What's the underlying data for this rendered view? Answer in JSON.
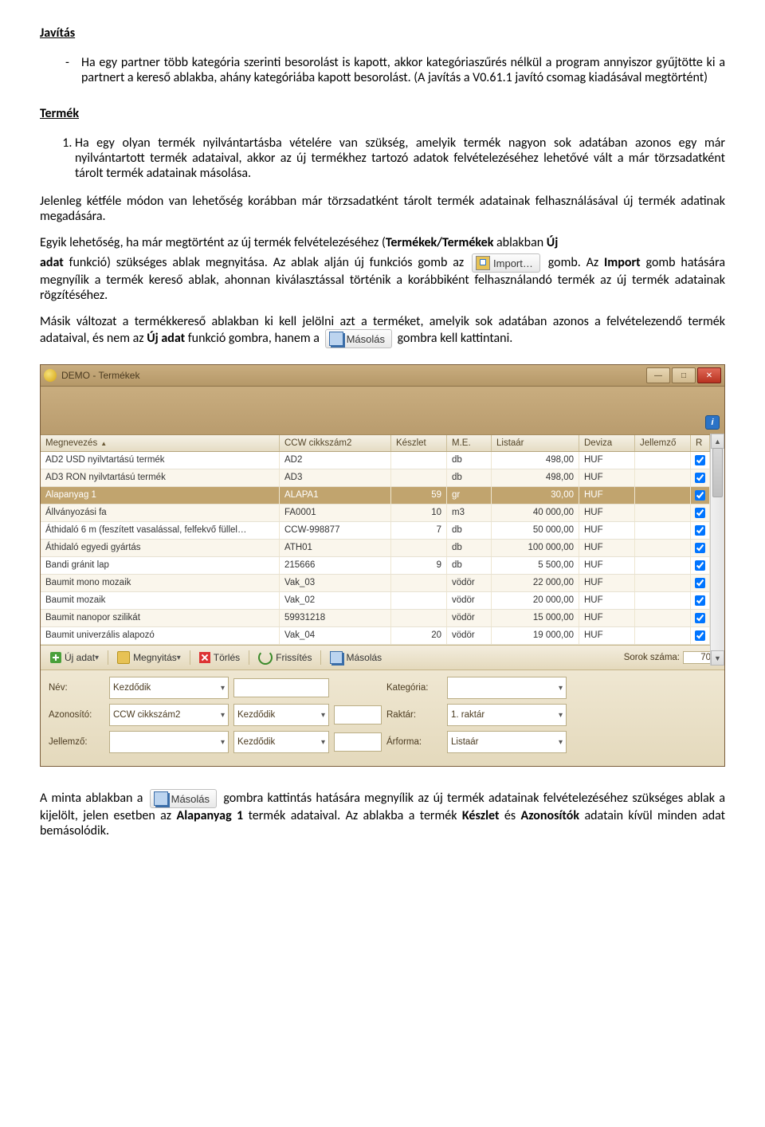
{
  "headings": {
    "javitas": "Javítás",
    "termek": "Termék"
  },
  "text": {
    "javitas_item": "Ha egy partner több kategória szerinti besorolást is kapott, akkor kategóriaszűrés nélkül a program annyiszor gyűjtötte ki a partnert a kereső ablakba, ahány kategóriába kapott besorolást. (A javítás a V0.61.1 javító csomag kiadásával megtörtént)",
    "termek_item": "Ha egy olyan termék nyilvántartásba vételére van szükség, amelyik termék nagyon sok adatában azonos egy már nyilvántartott termék adataival, akkor az új termékhez tartozó adatok felvételezéséhez lehetővé vált a már törzsadatként tárolt termék adatainak másolása.",
    "p1": "Jelenleg kétféle módon van lehetőség korábban már törzsadatként tárolt termék adatainak felhasználásával új termék adatinak megadására.",
    "p2a": "Egyik lehetőség, ha már megtörtént az új termék felvételezéséhez (",
    "p2b_bold": "Termékek/Termékek",
    "p2c": " ablakban ",
    "p2d_bold": "Új",
    "p3a_bold": "adat",
    "p3b": " funkció) szükséges ablak megnyitása. Az ablak alján új funkciós gomb az ",
    "p3c": " gomb. Az ",
    "p3d_bold": "Import",
    "p3e": " gomb hatására megnyílik a termék kereső ablak, ahonnan kiválasztással történik a korábbiként felhasználandó termék az új termék adatainak rögzítéséhez.",
    "p4a": "Másik változat a termékkereső ablakban ki kell jelölni azt a terméket, amelyik sok adatában azonos a felvételezendő termék adataival, és nem az ",
    "p4b_bold": "Új adat",
    "p4c": " funkció gombra, hanem a ",
    "p4d": " gombra kell kattintani.",
    "p5a": "A minta ablakban a ",
    "p5b": " gombra kattintás hatására megnyílik az új termék adatainak felvételezéséhez szükséges ablak a kijelölt, jelen esetben az ",
    "p5c_bold": "Alapanyag 1",
    "p5d": " termék adataival. Az ablakba a termék ",
    "p5e_bold": "Készlet",
    "p5f": " és ",
    "p5g_bold": "Azonosítók",
    "p5h": " adatain kívül minden adat bemásolódik."
  },
  "inline_buttons": {
    "import": "Import…",
    "masolas": "Másolás"
  },
  "window": {
    "title": "DEMO - Termékek",
    "columns": {
      "megnevezes": "Megnevezés",
      "ccw": "CCW cikkszám2",
      "keszlet": "Készlet",
      "me": "M.E.",
      "listaar": "Listaár",
      "deviza": "Deviza",
      "jellemzo": "Jellemző",
      "r": "R"
    },
    "rows": [
      {
        "meg": "AD2 USD nyilvtartású termék",
        "ccw": "AD2",
        "kesz": "",
        "me": "db",
        "ar": "498,00",
        "dev": "HUF",
        "jel": "",
        "r": true,
        "sel": false
      },
      {
        "meg": "AD3 RON nyilvtartású termék",
        "ccw": "AD3",
        "kesz": "",
        "me": "db",
        "ar": "498,00",
        "dev": "HUF",
        "jel": "",
        "r": true,
        "sel": false
      },
      {
        "meg": "Alapanyag 1",
        "ccw": "ALAPA1",
        "kesz": "59",
        "me": "gr",
        "ar": "30,00",
        "dev": "HUF",
        "jel": "",
        "r": true,
        "sel": true
      },
      {
        "meg": "Állványozási fa",
        "ccw": "FA0001",
        "kesz": "10",
        "me": "m3",
        "ar": "40 000,00",
        "dev": "HUF",
        "jel": "",
        "r": true,
        "sel": false
      },
      {
        "meg": "Áthidaló 6 m (feszített vasalással, felfekvő füllel…",
        "ccw": "CCW-998877",
        "kesz": "7",
        "me": "db",
        "ar": "50 000,00",
        "dev": "HUF",
        "jel": "",
        "r": true,
        "sel": false
      },
      {
        "meg": "Áthidaló egyedi gyártás",
        "ccw": "ATH01",
        "kesz": "",
        "me": "db",
        "ar": "100 000,00",
        "dev": "HUF",
        "jel": "",
        "r": true,
        "sel": false
      },
      {
        "meg": "Bandi gránit lap",
        "ccw": "215666",
        "kesz": "9",
        "me": "db",
        "ar": "5 500,00",
        "dev": "HUF",
        "jel": "",
        "r": true,
        "sel": false
      },
      {
        "meg": "Baumit mono mozaik",
        "ccw": "Vak_03",
        "kesz": "",
        "me": "vödör",
        "ar": "22 000,00",
        "dev": "HUF",
        "jel": "",
        "r": true,
        "sel": false
      },
      {
        "meg": "Baumit mozaik",
        "ccw": "Vak_02",
        "kesz": "",
        "me": "vödör",
        "ar": "20 000,00",
        "dev": "HUF",
        "jel": "",
        "r": true,
        "sel": false
      },
      {
        "meg": "Baumit nanopor szilikát",
        "ccw": "59931218",
        "kesz": "",
        "me": "vödör",
        "ar": "15 000,00",
        "dev": "HUF",
        "jel": "",
        "r": true,
        "sel": false
      },
      {
        "meg": "Baumit univerzális alapozó",
        "ccw": "Vak_04",
        "kesz": "20",
        "me": "vödör",
        "ar": "19 000,00",
        "dev": "HUF",
        "jel": "",
        "r": true,
        "sel": false
      }
    ],
    "toolbar": {
      "uj_adat": "Új adat",
      "megnyitas": "Megnyitás",
      "torles": "Törlés",
      "frissites": "Frissítés",
      "masolas": "Másolás",
      "sorok_label": "Sorok száma:",
      "sorok_value": "70"
    },
    "filters": {
      "nev": "Név:",
      "azonosito": "Azonosító:",
      "jellemzo": "Jellemző:",
      "kategoria": "Kategória:",
      "raktar": "Raktár:",
      "arforma": "Árforma:",
      "kezdodik": "Kezdődik",
      "ccw_opt": "CCW cikkszám2",
      "raktar_val": "1. raktár",
      "arforma_val": "Listaár"
    }
  }
}
